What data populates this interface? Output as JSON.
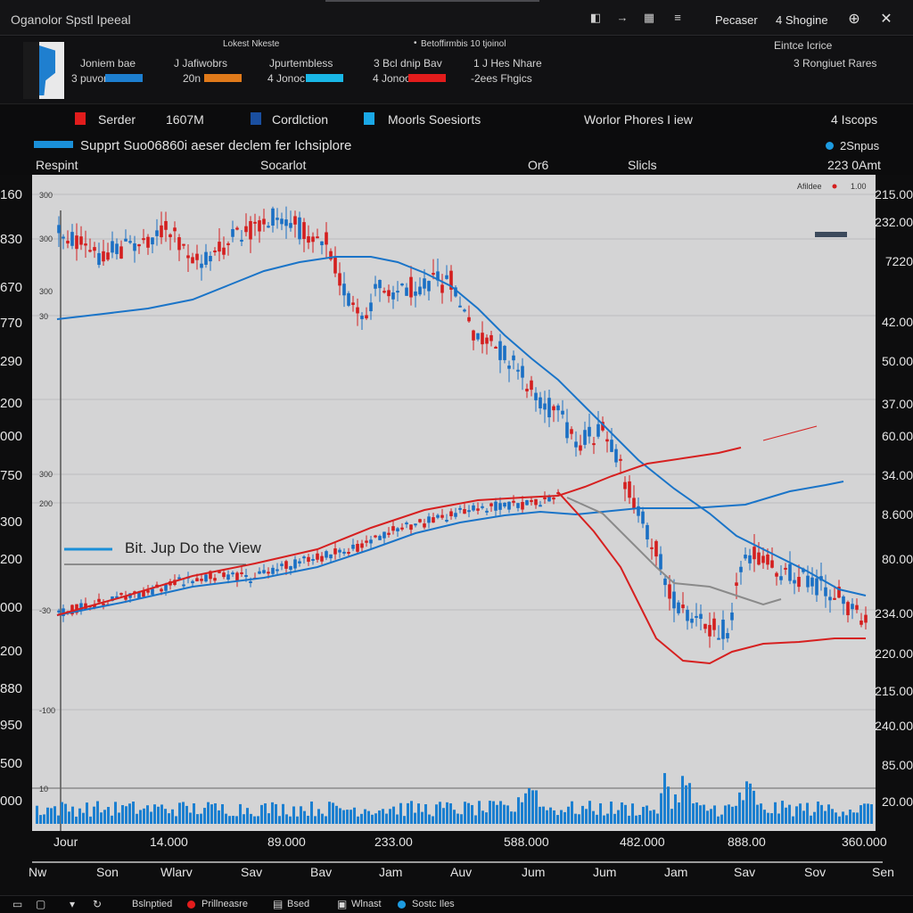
{
  "window": {
    "title": "Oganolor Spstl Ipeeal",
    "right_label_1": "Pecaser",
    "right_label_2": "4 Shogine",
    "icons": [
      "search-icon",
      "close-icon"
    ]
  },
  "panel": {
    "heading_left": "Lokest Nkeste",
    "heading_mid": "Betoffirmbis 10 tjoinol",
    "heading_right": "Eintce Icrice",
    "right_sub": "3 Rongiuet Rares",
    "items": [
      {
        "label": "Joniem bae",
        "sub": "3 puvor",
        "color": "#1d7fd0"
      },
      {
        "label": "J Jafiwobrs",
        "sub": "20n",
        "color": "#e07a1a"
      },
      {
        "label": "Jpurtembless",
        "sub": "4 Jonoc",
        "color": "#19b7e6"
      },
      {
        "label": "3 Bcl dnip Bav",
        "sub": "4 Jonoo",
        "color": "#e21c1c"
      },
      {
        "label": "1 J Hes Nhare",
        "sub": "-2ees Fhgics"
      }
    ]
  },
  "toolbar": {
    "items": [
      {
        "label": "Serder",
        "value": "1607M",
        "color": "#e21c1c"
      },
      {
        "label": "Cordlction",
        "color": "#1a4fa0"
      },
      {
        "label": "Moorls Soesiorts",
        "color": "#1aa8e6"
      }
    ],
    "center_label": "Worlor Phores I iew",
    "right_label": "4 Iscops"
  },
  "info": {
    "banner": "Supprt Suo06860i aeser declem fer Ichsiplore",
    "right_tag": "2Snpus",
    "col1": "Respint",
    "col2": "Socarlot",
    "col3": "Or6",
    "col4": "Slicls",
    "col5": "223 0Amt"
  },
  "chart_data": {
    "type": "line",
    "title": "",
    "legend_top_right": "Afildee",
    "legend_top_right_value": "1.00",
    "annotation": "Bit. Jup Do the View",
    "inner_ticks": [
      "300",
      "300",
      "300",
      "30",
      "300",
      "200",
      "-30",
      "-100",
      "10"
    ],
    "left_ticks": [
      "160",
      "830",
      "670",
      "770",
      "290",
      "200",
      "000",
      "750",
      "300",
      "200",
      "000",
      "200",
      "880",
      "950",
      "500",
      "000"
    ],
    "right_ticks": [
      "215.00",
      "232.00",
      "7220",
      "42.00",
      "50.00",
      "37.00",
      "60.00",
      "34.00",
      "8.600",
      "80.00",
      "234.00",
      "220.00",
      "215.00",
      "240.00",
      "85.00",
      "20.00"
    ],
    "x_ticks_row1": [
      "Jour",
      "14.000",
      "89.000",
      "233.00",
      "588.000",
      "482.000",
      "888.00",
      "360.000"
    ],
    "x_ticks_row2": [
      "Nw",
      "Son",
      "Wlarv",
      "Sav",
      "Bav",
      "Jam",
      "Auv",
      "Jum",
      "Jum",
      "Jam",
      "Sav",
      "Sov",
      "Sen"
    ],
    "colors": {
      "up": "#1a6fc4",
      "down": "#d41e1e",
      "ma_blue": "#1a74c8",
      "ma_red": "#d62020",
      "ma_gray": "#8a8a8a",
      "volume": "#1b7fd0"
    }
  },
  "statusbar": {
    "items": [
      "Bslnptied",
      "Prillneasre",
      "Bsed",
      "Wlnast",
      "Sostc Iles"
    ]
  }
}
